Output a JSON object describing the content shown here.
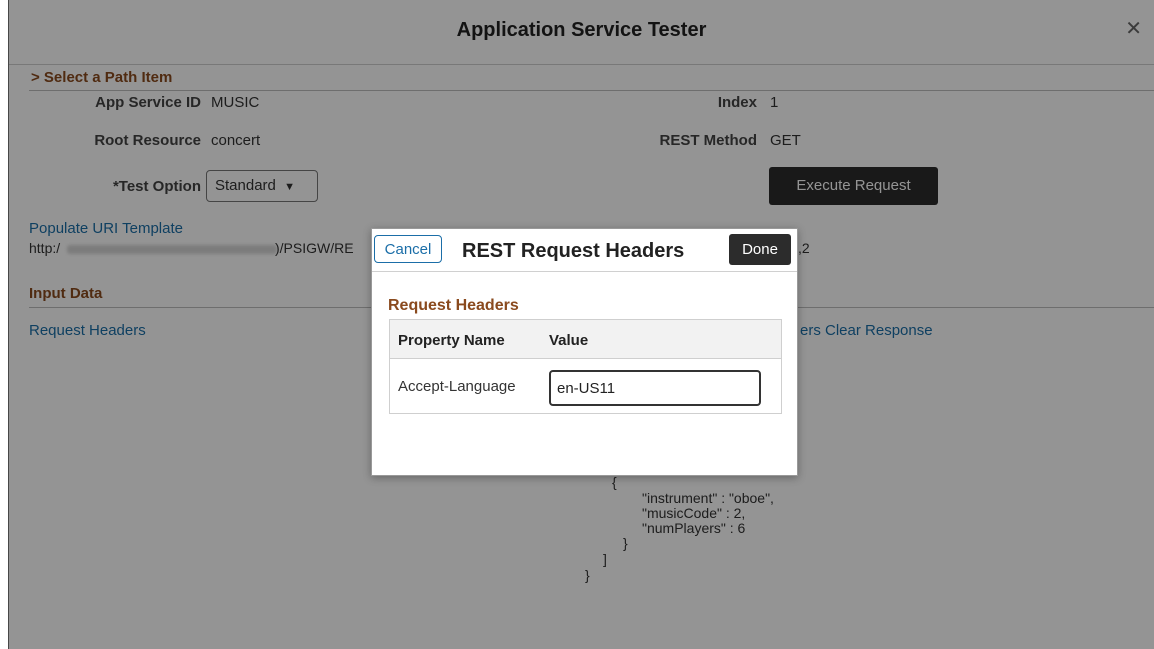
{
  "window": {
    "title": "Application Service Tester"
  },
  "path_section": {
    "header": "> Select a Path Item",
    "app_service_id_label": "App Service ID",
    "app_service_id_value": "MUSIC",
    "index_label": "Index",
    "index_value": "1",
    "root_resource_label": "Root Resource",
    "root_resource_value": "concert",
    "rest_method_label": "REST Method",
    "rest_method_value": "GET",
    "test_option_label": "*Test Option",
    "test_option_value": "Standard",
    "execute_label": "Execute Request",
    "populate_link": "Populate URI Template",
    "uri_prefix": "http:/",
    "uri_suffix": ")/PSIGW/RE",
    "uri_tail": ",2"
  },
  "input_section": {
    "header": "Input Data",
    "request_headers_link": "Request Headers",
    "clear_response_partial": "ers Clear Response"
  },
  "response_code": {
    "open_brace": "{",
    "instrument": "\"instrument\" : \"oboe\",",
    "music_code": "\"musicCode\" : 2,",
    "num_players": "\"numPlayers\" : 6",
    "close_brace_inner": "}",
    "close_bracket": "]",
    "close_brace_outer": "}"
  },
  "modal": {
    "cancel_label": "Cancel",
    "title": "REST Request Headers",
    "done_label": "Done",
    "section_header": "Request Headers",
    "columns": [
      "Property Name",
      "Value"
    ],
    "rows": [
      {
        "property": "Accept-Language",
        "value": "en-US11"
      }
    ]
  }
}
